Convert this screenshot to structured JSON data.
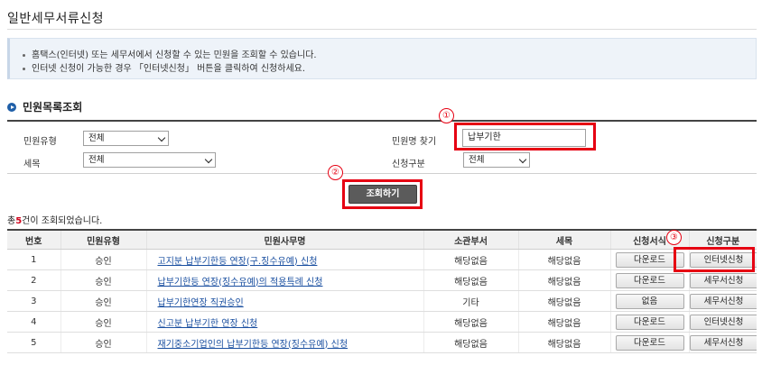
{
  "page": {
    "title": "일반세무서류신청"
  },
  "notice": {
    "line1": "홈택스(인터넷) 또는 세무서에서 신청할 수 있는 민원을 조회할 수 있습니다.",
    "line2": "인터넷 신청이 가능한 경우 「인터넷신청」 버튼을 클릭하여 신청하세요."
  },
  "search": {
    "section_title": "민원목록조회",
    "type_label": "민원유형",
    "type_value": "전체",
    "tax_label": "세목",
    "tax_value": "전체",
    "name_label": "민원명 찾기",
    "name_value": "납부기한",
    "apply_label": "신청구분",
    "apply_value": "전체",
    "button_label": "조회하기"
  },
  "annotations": {
    "n1": "①",
    "n2": "②",
    "n3": "③",
    "highlight_color": "#e60012"
  },
  "result": {
    "count_prefix": "총",
    "count": "5",
    "count_suffix": "건이 조회되었습니다."
  },
  "table": {
    "headers": [
      "번호",
      "민원유형",
      "민원사무명",
      "소관부서",
      "세목",
      "신청서식",
      "신청구분"
    ],
    "rows": [
      {
        "no": "1",
        "type": "승인",
        "name": "고지분 납부기한등 연장(구.징수유예) 신청",
        "dept": "해당없음",
        "tax": "해당없음",
        "form": "다운로드",
        "apply": "인터넷신청"
      },
      {
        "no": "2",
        "type": "승인",
        "name": "납부기한등 연장(징수유예)의 적용특례 신청",
        "dept": "해당없음",
        "tax": "해당없음",
        "form": "다운로드",
        "apply": "세무서신청"
      },
      {
        "no": "3",
        "type": "승인",
        "name": "납부기한연장 직권승인",
        "dept": "기타",
        "tax": "해당없음",
        "form": "없음",
        "apply": "세무서신청"
      },
      {
        "no": "4",
        "type": "승인",
        "name": "신고분 납부기한 연장 신청",
        "dept": "해당없음",
        "tax": "해당없음",
        "form": "다운로드",
        "apply": "인터넷신청"
      },
      {
        "no": "5",
        "type": "승인",
        "name": "재기중소기업인의 납부기한등 연장(징수유예) 신청",
        "dept": "해당없음",
        "tax": "해당없음",
        "form": "다운로드",
        "apply": "세무서신청"
      }
    ]
  }
}
